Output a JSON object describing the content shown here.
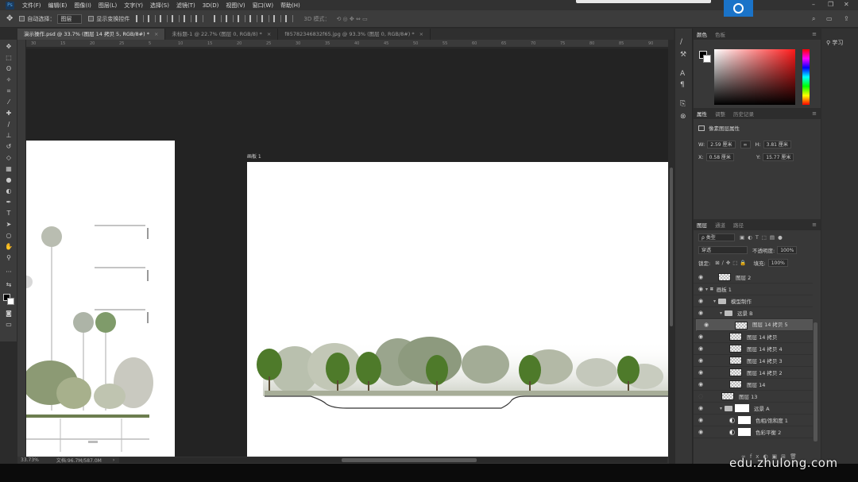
{
  "app": {
    "logo": "Ps",
    "accent": "#1a73c8"
  },
  "menu": [
    "文件(F)",
    "编辑(E)",
    "图像(I)",
    "图层(L)",
    "文字(Y)",
    "选择(S)",
    "滤镜(T)",
    "3D(D)",
    "视图(V)",
    "窗口(W)",
    "帮助(H)"
  ],
  "options": {
    "auto_select_label": "自动选择：",
    "auto_select_value": "图层",
    "show_transform_label": "显示变换控件",
    "mode_3d_label": "3D 模式："
  },
  "tabs": [
    {
      "label": "演示操作.psd @ 33.7% (图层 14 拷贝 5, RGB/8#) *",
      "active": true
    },
    {
      "label": "未标题-1 @ 22.7% (图层 0, RGB/8) *",
      "active": false
    },
    {
      "label": "f85782346832f65.jpg @ 93.3% (图层 0, RGB/8#) *",
      "active": false
    }
  ],
  "ruler_ticks": [
    "30",
    "15",
    "20",
    "25",
    "5",
    "10",
    "15",
    "20",
    "25",
    "30",
    "35",
    "40",
    "45",
    "50",
    "55",
    "60",
    "65",
    "70",
    "75",
    "80",
    "85",
    "90"
  ],
  "canvas": {
    "artboard_label": "画板 1"
  },
  "status": {
    "zoom": "33.73%",
    "doc": "文档:96.7M/587.0M"
  },
  "panels": {
    "color": {
      "tabs": [
        "颜色",
        "色板"
      ],
      "fg": "#000000",
      "bg": "#ffffff"
    },
    "properties": {
      "tabs": [
        "属性",
        "调整",
        "历史记录"
      ],
      "layer_kind": "像素图层属性",
      "w_label": "W:",
      "w_value": "2.59 厘米",
      "h_label": "H:",
      "h_value": "3.81 厘米",
      "x_label": "X:",
      "x_value": "0.58 厘米",
      "y_label": "Y:",
      "y_value": "15.77 厘米",
      "link_icon": "∞"
    },
    "layers": {
      "tabs": [
        "图层",
        "通道",
        "路径"
      ],
      "filter_label": "ρ 类型",
      "blend_mode": "穿透",
      "opacity_label": "不透明度:",
      "opacity_value": "100%",
      "lock_label": "锁定:",
      "fill_label": "填充:",
      "fill_value": "100%",
      "items": [
        {
          "name": "图层 2",
          "type": "pixel",
          "indent": 0,
          "selected": false
        },
        {
          "name": "画板 1",
          "type": "artboard",
          "indent": 0,
          "selected": false
        },
        {
          "name": "模型制作",
          "type": "folder",
          "indent": 1,
          "selected": false
        },
        {
          "name": "远景 B",
          "type": "folder",
          "indent": 2,
          "selected": false
        },
        {
          "name": "图层 14 拷贝 5",
          "type": "pixel",
          "indent": 3,
          "selected": true
        },
        {
          "name": "图层 14 拷贝",
          "type": "pixel",
          "indent": 3,
          "selected": false
        },
        {
          "name": "图层 14 拷贝 4",
          "type": "pixel",
          "indent": 3,
          "selected": false
        },
        {
          "name": "图层 14 拷贝 3",
          "type": "pixel",
          "indent": 3,
          "selected": false
        },
        {
          "name": "图层 14 拷贝 2",
          "type": "pixel",
          "indent": 3,
          "selected": false
        },
        {
          "name": "图层 14",
          "type": "pixel",
          "indent": 3,
          "selected": false
        },
        {
          "name": "图层 13",
          "type": "pixel",
          "indent": 2,
          "selected": false
        },
        {
          "name": "远景 A",
          "type": "folder",
          "indent": 2,
          "selected": false
        },
        {
          "name": "色相/饱和度 1",
          "type": "adjust",
          "indent": 3,
          "selected": false
        },
        {
          "name": "色彩平衡 2",
          "type": "adjust",
          "indent": 3,
          "selected": false
        }
      ]
    }
  },
  "right_panel": {
    "learn": "学习"
  },
  "watermark": "edu.zhulong.com"
}
